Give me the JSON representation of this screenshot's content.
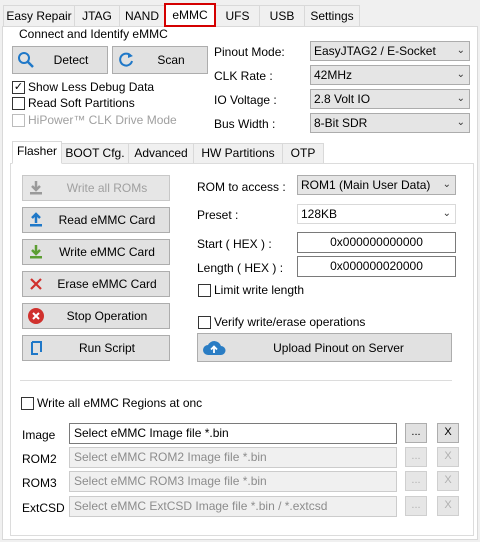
{
  "top_tabs": [
    "Easy Repair",
    "JTAG",
    "NAND",
    "eMMC",
    "UFS",
    "USB",
    "Settings"
  ],
  "connect_group": {
    "title": "Connect and Identify eMMC",
    "detect_label": "Detect",
    "scan_label": "Scan",
    "pinout_mode_label": "Pinout Mode:",
    "pinout_mode_value": "EasyJTAG2 / E-Socket",
    "clk_rate_label": "CLK Rate :",
    "clk_rate_value": "42MHz",
    "io_voltage_label": "IO Voltage :",
    "io_voltage_value": "2.8 Volt IO",
    "bus_width_label": "Bus Width :",
    "bus_width_value": "8-Bit SDR",
    "show_less_debug": "Show Less Debug Data",
    "read_soft_partitions": "Read Soft Partitions",
    "hipower": "HiPower™ CLK Drive Mode"
  },
  "sub_tabs": [
    "Flasher",
    "BOOT Cfg.",
    "Advanced",
    "HW Partitions",
    "OTP"
  ],
  "flasher": {
    "write_all_roms": "Write all ROMs",
    "read_card": "Read eMMC Card",
    "write_card": "Write eMMC Card",
    "erase_card": "Erase eMMC Card",
    "stop_operation": "Stop Operation",
    "run_script": "Run Script",
    "rom_access_label": "ROM to access :",
    "rom_access_value": "ROM1 (Main User Data)",
    "preset_label": "Preset :",
    "preset_value": "128KB",
    "start_label": "Start ( HEX ) :",
    "start_value": "0x000000000000",
    "length_label": "Length ( HEX ) :",
    "length_value": "0x000000020000",
    "limit_write": "Limit write length",
    "verify": "Verify write/erase operations",
    "upload_pinout": "Upload Pinout on Server",
    "write_all_regions": "Write all eMMC Regions at onc",
    "image_label": "Image",
    "image_value": "Select eMMC Image file *.bin",
    "rom2_label": "ROM2",
    "rom2_value": "Select eMMC ROM2 Image file *.bin",
    "rom3_label": "ROM3",
    "rom3_value": "Select eMMC ROM3 Image file *.bin",
    "extcsd_label": "ExtCSD",
    "extcsd_value": "Select eMMC ExtCSD Image file *.bin / *.extcsd",
    "browse": "...",
    "clear": "X"
  },
  "colors": {
    "active_tab_outline": "#d40000",
    "icon_blue": "#1f78c8",
    "icon_green": "#5c9e32",
    "icon_red": "#d0312d",
    "upload_blue": "#2a7dc4"
  }
}
